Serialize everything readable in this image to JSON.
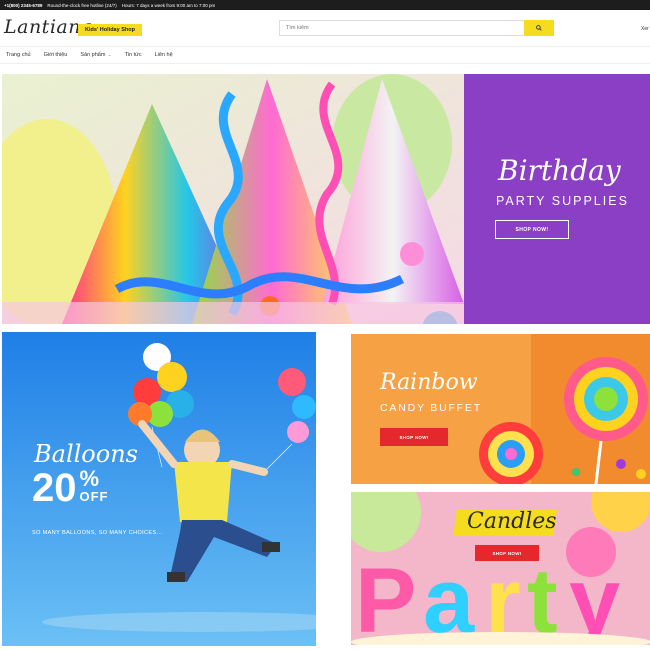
{
  "topbar": {
    "phone": "+1(800) 2345-6789",
    "hotline": "Round-the-clock free hotline (24/7)",
    "hours": "Hours: 7 days a week from 9:00 am to 7:00 pm"
  },
  "header": {
    "logo": "Lantiana",
    "badge": "Kids' Holiday Shop",
    "search_placeholder": "Tìm kiếm",
    "account": "Xer"
  },
  "nav": {
    "items": [
      {
        "label": "Trang chủ"
      },
      {
        "label": "Giới thiệu"
      },
      {
        "label": "Sản phẩm"
      },
      {
        "label": "Tin tức"
      },
      {
        "label": "Liên hệ"
      }
    ]
  },
  "banners": {
    "birthday": {
      "title": "Birthday",
      "subtitle": "PARTY SUPPLIES",
      "button": "SHOP NOW!"
    },
    "balloons": {
      "title": "Balloons",
      "discount": "20",
      "percent": "%",
      "off": "OFF",
      "tagline": "SO MANY BALLOONS, SO MANY CHOICES..."
    },
    "rainbow": {
      "title": "Rainbow",
      "subtitle": "CANDY BUFFET",
      "button": "SHOP NOW!"
    },
    "candles": {
      "title": "Candles",
      "button": "SHOP NOW!",
      "word": "Party"
    }
  },
  "colors": {
    "accent_yellow": "#f6dc1f",
    "purple": "#8b3fc4",
    "red_button": "#e4282b",
    "dark_bar": "#1d1d1d"
  }
}
